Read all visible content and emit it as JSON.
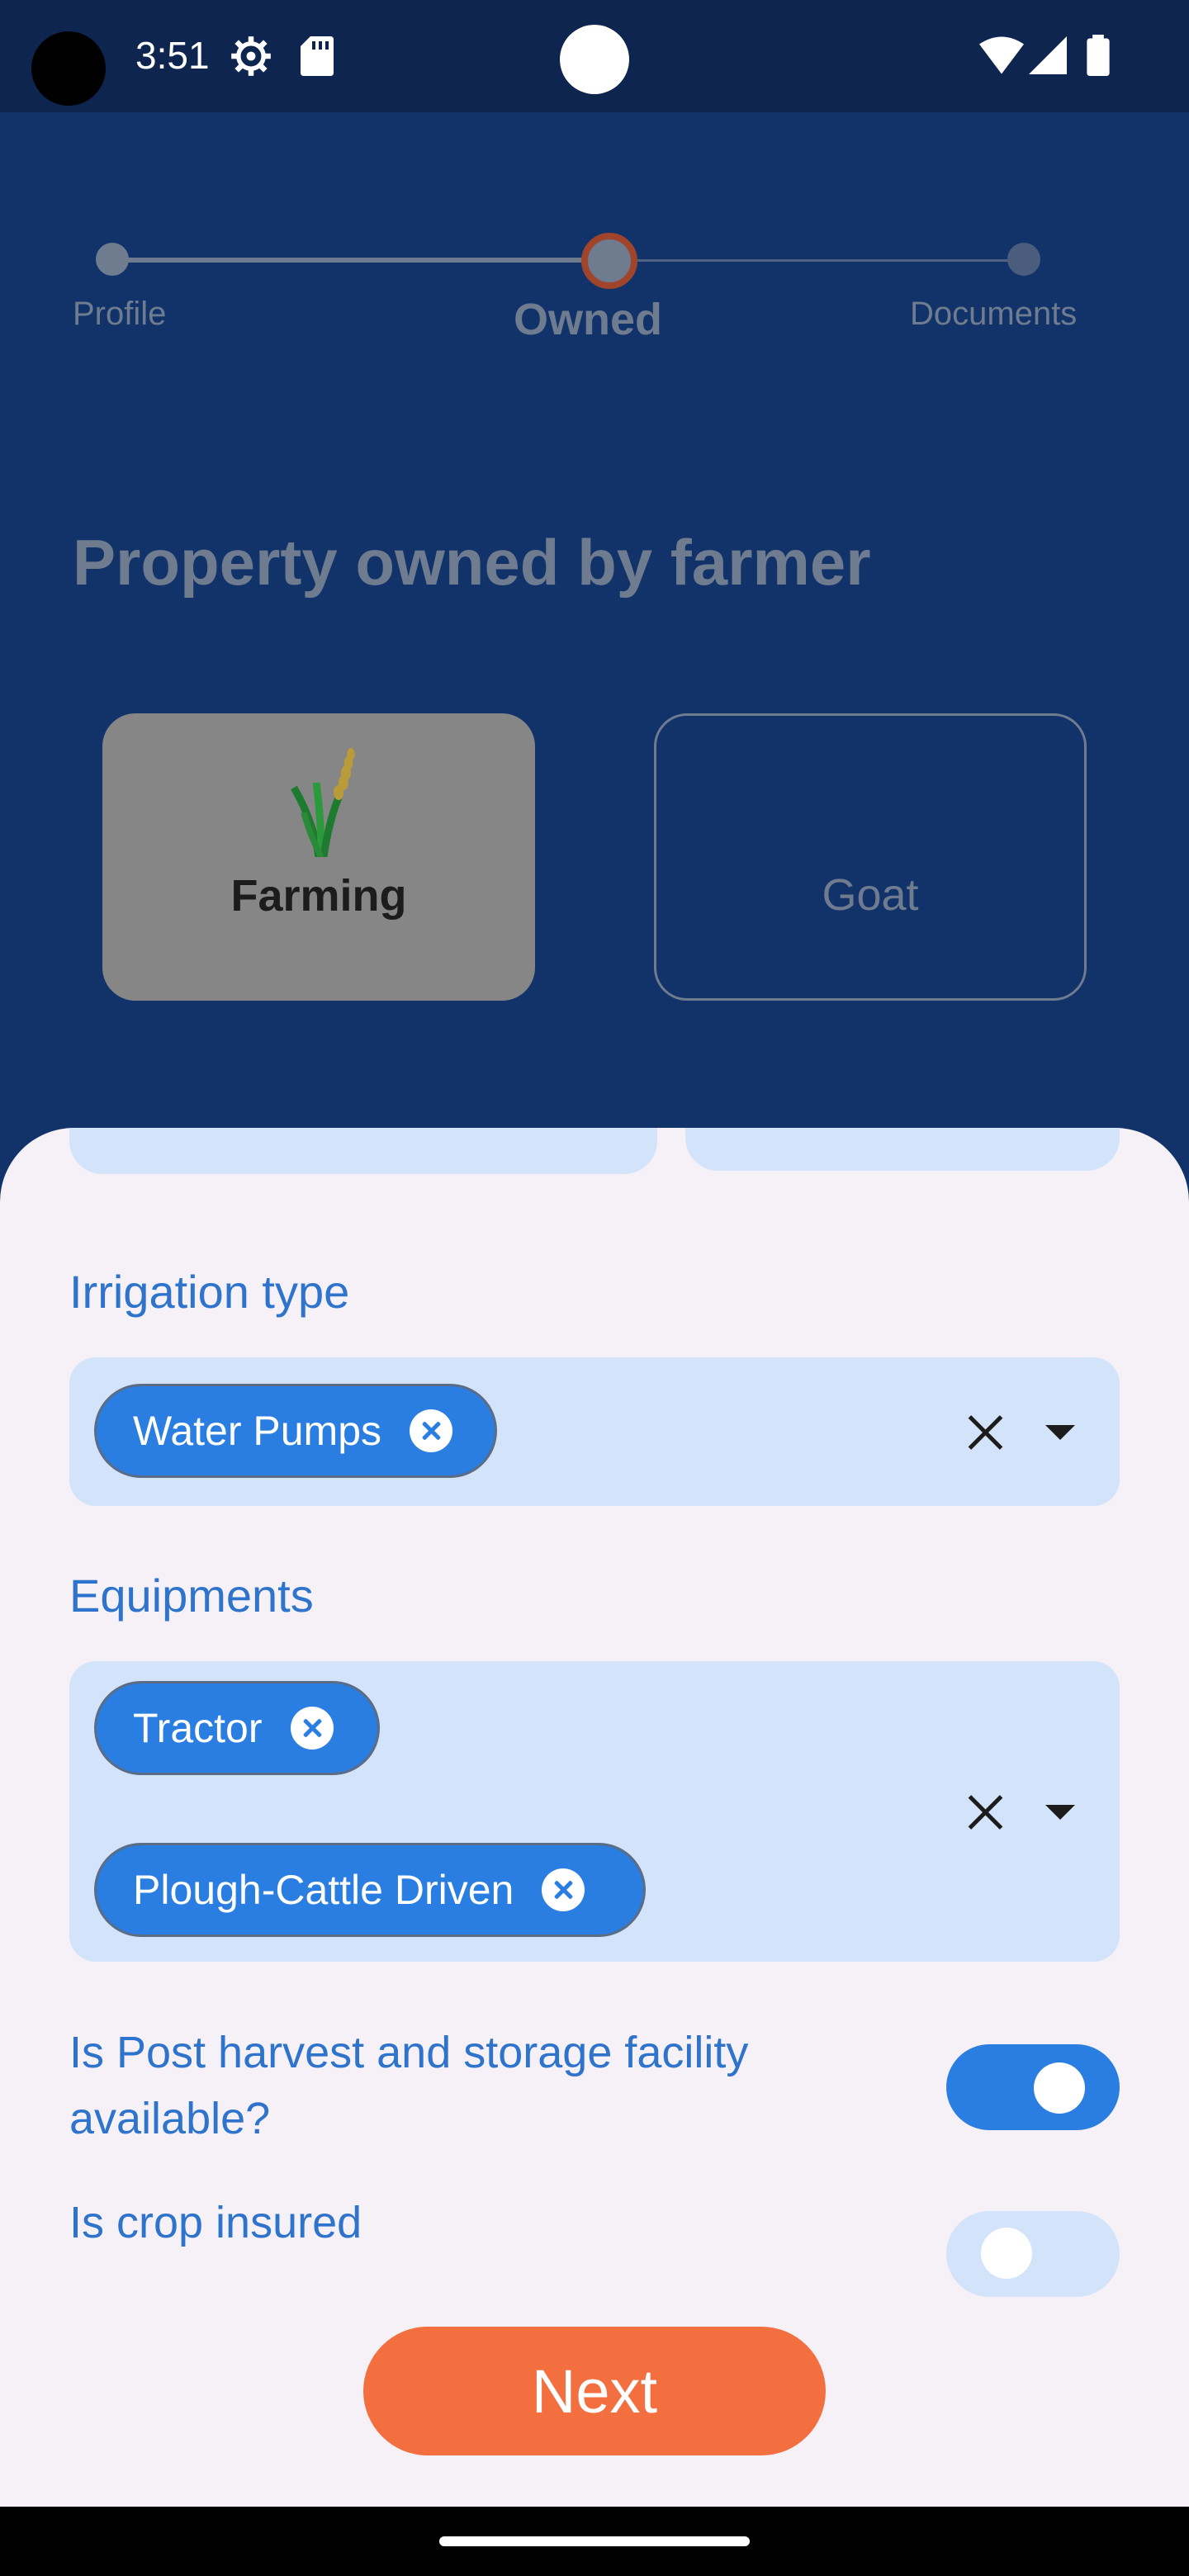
{
  "status_bar": {
    "time": "3:51",
    "icons": [
      "gear-icon",
      "sd-card-icon",
      "wifi-icon",
      "signal-icon",
      "battery-icon"
    ]
  },
  "stepper": {
    "steps": [
      {
        "label": "Profile",
        "state": "done"
      },
      {
        "label": "Owned",
        "state": "current"
      },
      {
        "label": "Documents",
        "state": "todo"
      }
    ]
  },
  "page": {
    "title": "Property owned by farmer"
  },
  "categories": [
    {
      "label": "Farming",
      "selected": true,
      "icon": "wheat-icon"
    },
    {
      "label": "Goat",
      "selected": false
    }
  ],
  "form": {
    "irrigation": {
      "label": "Irrigation type",
      "chips": [
        "Water Pumps"
      ]
    },
    "equipments": {
      "label": "Equipments",
      "chips": [
        "Tractor",
        "Plough-Cattle Driven"
      ]
    },
    "post_harvest": {
      "question": "Is Post harvest and storage facility available?",
      "value": true
    },
    "crop_insured": {
      "question": "Is crop insured",
      "value": false
    },
    "next_label": "Next"
  },
  "colors": {
    "background": "#11336a",
    "accent": "#2a7de1",
    "primary_button": "#f46f40",
    "sheet": "#f6f1f7"
  }
}
